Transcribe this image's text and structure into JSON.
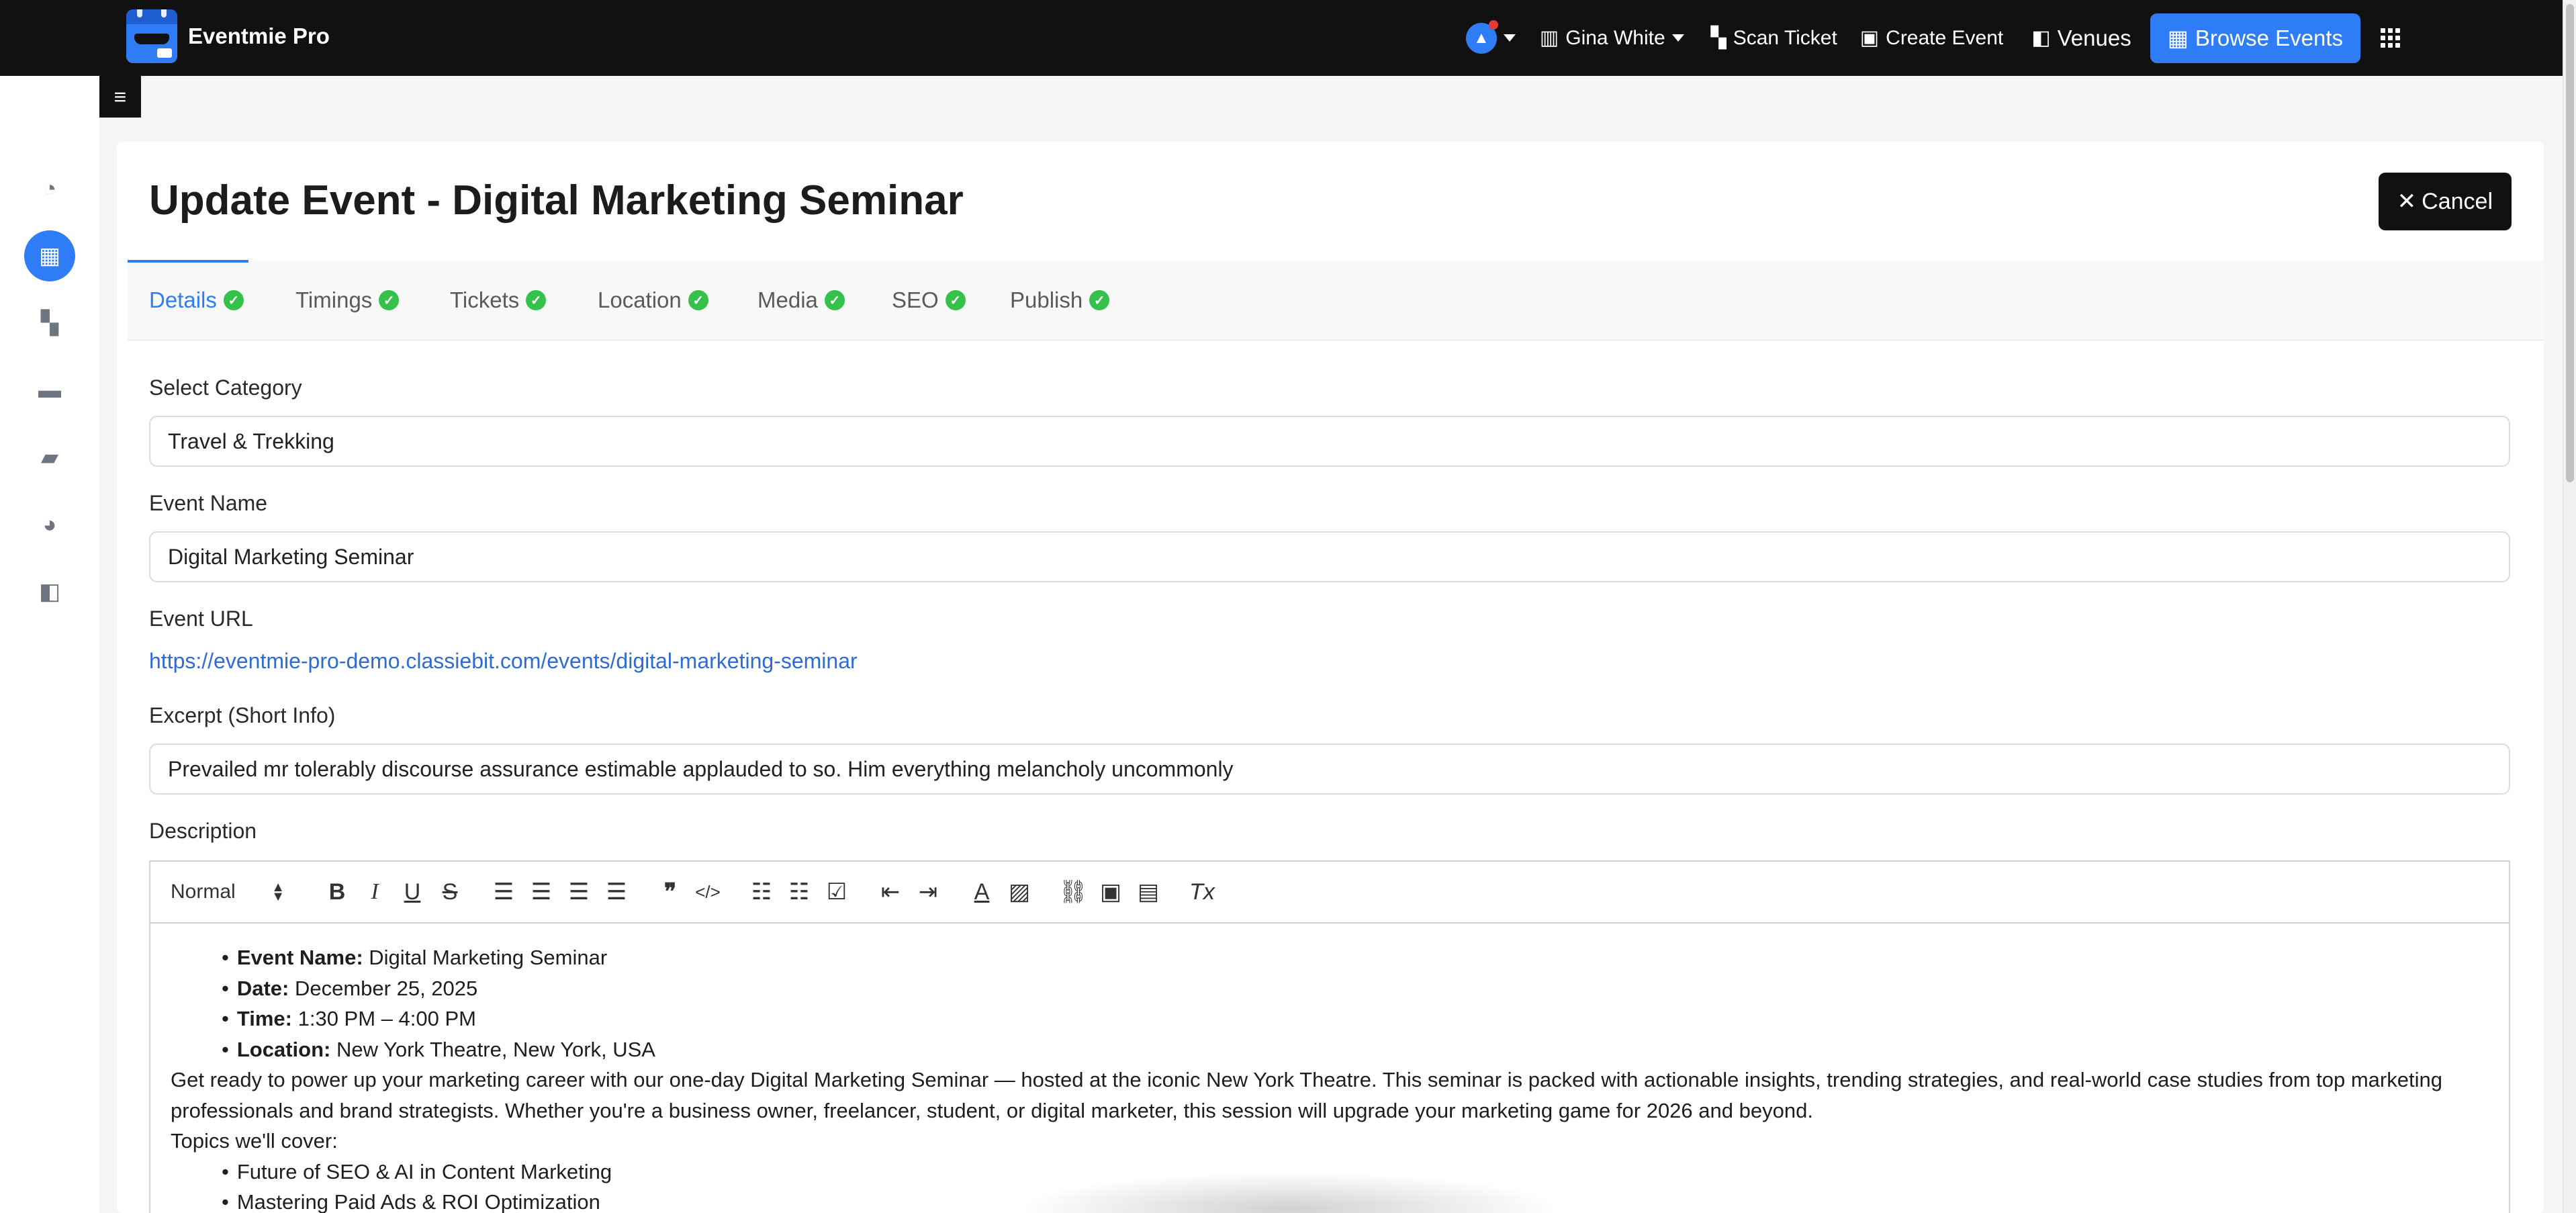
{
  "app": {
    "brand_name": "Eventmie Pro"
  },
  "navbar": {
    "user_name": "Gina White",
    "scan_ticket": "Scan Ticket",
    "create_event": "Create Event",
    "venues": "Venues",
    "browse_events": "Browse Events",
    "icons": [
      "bell-icon",
      "building-icon",
      "qr-icon",
      "calendar-plus-icon",
      "map-icon",
      "calendar-icon",
      "apps-grid-icon"
    ]
  },
  "sidebar": {
    "items": [
      {
        "name": "dashboard-icon",
        "glyph": "◔"
      },
      {
        "name": "calendar-icon",
        "glyph": "▦",
        "active": true
      },
      {
        "name": "qr-scan-icon",
        "glyph": "▚"
      },
      {
        "name": "ticket-icon",
        "glyph": "▬"
      },
      {
        "name": "wallet-icon",
        "glyph": "▰"
      },
      {
        "name": "users-icon",
        "glyph": "◕"
      },
      {
        "name": "venues-map-icon",
        "glyph": "◧"
      }
    ]
  },
  "page": {
    "title": "Update Event - Digital Marketing Seminar",
    "cancel": "Cancel"
  },
  "tabs": [
    {
      "label": "Details",
      "active": true
    },
    {
      "label": "Timings"
    },
    {
      "label": "Tickets"
    },
    {
      "label": "Location"
    },
    {
      "label": "Media"
    },
    {
      "label": "SEO"
    },
    {
      "label": "Publish"
    }
  ],
  "form": {
    "category_label": "Select Category",
    "category_value": "Travel & Trekking",
    "event_name_label": "Event Name",
    "event_name_value": "Digital Marketing Seminar",
    "event_url_label": "Event URL",
    "event_url_value": "https://eventmie-pro-demo.classiebit.com/events/digital-marketing-seminar",
    "excerpt_label": "Excerpt (Short Info)",
    "excerpt_value": "Prevailed mr tolerably discourse assurance estimable applauded to so. Him everything melancholy uncommonly",
    "description_label": "Description"
  },
  "editor": {
    "format_select": "Normal",
    "bullets_details": [
      {
        "key": "Event Name:",
        "value": " Digital Marketing Seminar"
      },
      {
        "key": "Date:",
        "value": " December 25, 2025"
      },
      {
        "key": "Time:",
        "value": " 1:30 PM – 4:00 PM"
      },
      {
        "key": "Location:",
        "value": " New York Theatre, New York, USA"
      }
    ],
    "paragraph": "Get ready to power up your marketing career with our one-day Digital Marketing Seminar — hosted at the iconic New York Theatre. This seminar is packed with actionable insights, trending strategies, and real-world case studies from top marketing professionals and brand strategists. Whether you're a business owner, freelancer, student, or digital marketer, this session will upgrade your marketing game for 2026 and beyond.",
    "topics_heading": "Topics we'll cover:",
    "topics": [
      "Future of SEO & AI in Content Marketing",
      "Mastering Paid Ads & ROI Optimization"
    ]
  },
  "colors": {
    "accent": "#2f7df6",
    "navbar_bg": "#111111",
    "success": "#34c24a"
  }
}
